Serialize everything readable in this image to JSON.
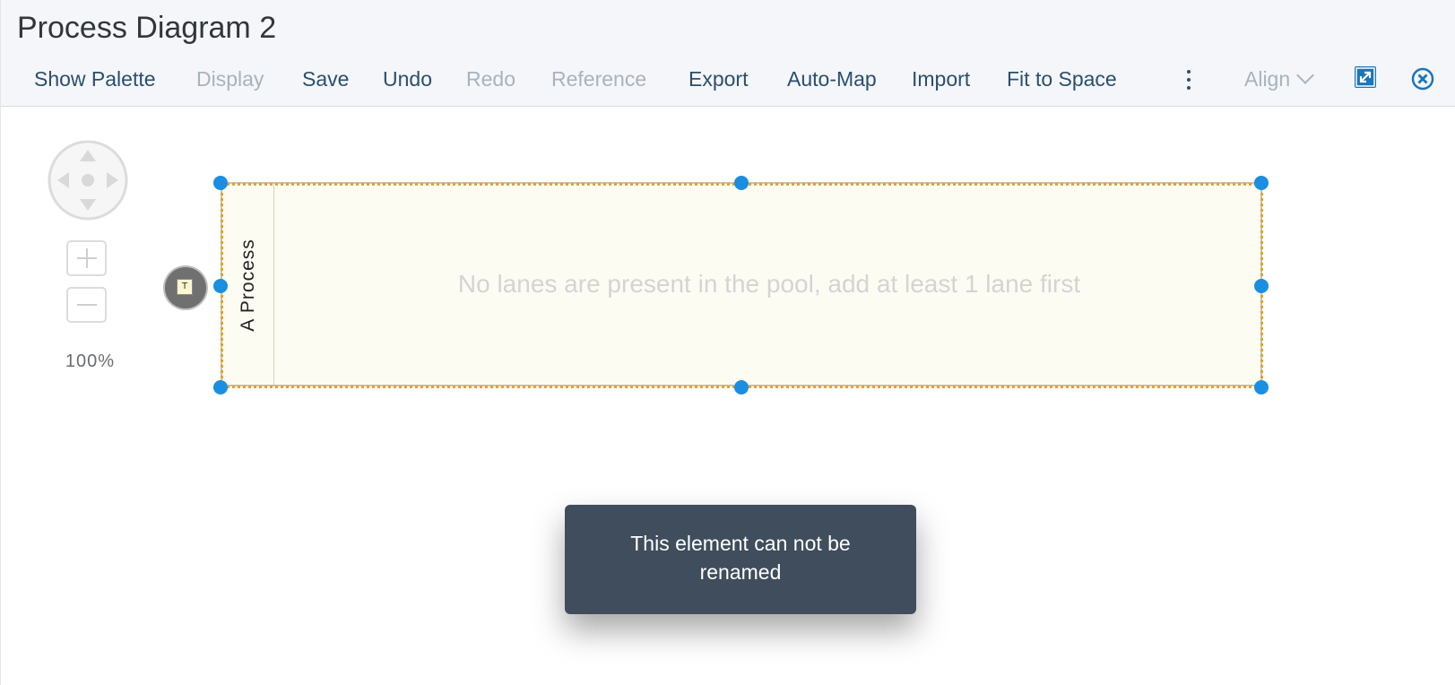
{
  "header": {
    "title": "Process Diagram 2"
  },
  "toolbar": {
    "show_palette": "Show Palette",
    "display": "Display",
    "save": "Save",
    "undo": "Undo",
    "redo": "Redo",
    "reference": "Reference",
    "export": "Export",
    "auto_map": "Auto-Map",
    "import": "Import",
    "fit_to_space": "Fit to Space",
    "align": "Align",
    "icons": {
      "more": "more-vertical-icon",
      "align_chevron": "chevron-down-icon",
      "expand": "expand-icon",
      "close": "close-circle-icon"
    },
    "colors": {
      "enabled_text": "#2c4e6e",
      "disabled_text": "#a7b3bf",
      "accent": "#1b75bb"
    }
  },
  "navigation": {
    "zoom_level": "100%",
    "icons": {
      "pan": "pan-navigation-icon",
      "zoom_in": "plus-icon",
      "zoom_out": "minus-icon"
    }
  },
  "canvas": {
    "pool": {
      "name": "A Process",
      "empty_message": "No lanes are present in the pool, add at least 1 lane first",
      "fill_color": "#fdfcf3",
      "selection_color": "#e6a02c",
      "handle_color": "#1a8ee0"
    },
    "text_tool_icon": "text-tool-icon"
  },
  "toast": {
    "line1": "This element can not be",
    "line2": "renamed",
    "background": "#3f4d5c"
  }
}
